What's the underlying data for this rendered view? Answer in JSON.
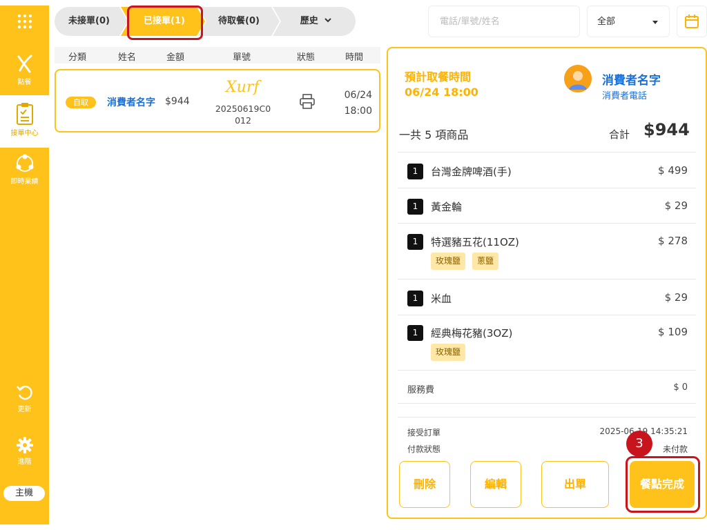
{
  "sidebar": {
    "items": [
      {
        "label": "點餐"
      },
      {
        "label": "接單中心"
      },
      {
        "label": "即時業績"
      },
      {
        "label": "更新"
      },
      {
        "label": "進階"
      }
    ],
    "host_label": "主機"
  },
  "tabs": [
    {
      "label": "未接單(0)"
    },
    {
      "label": "已接單(1)"
    },
    {
      "label": "待取餐(0)"
    },
    {
      "label": "歷史"
    }
  ],
  "search": {
    "placeholder": "電話/單號/姓名"
  },
  "filter": {
    "value": "全部"
  },
  "list_headers": [
    "分類",
    "姓名",
    "金額",
    "單號",
    "狀態",
    "時間"
  ],
  "order": {
    "type": "自取",
    "name": "消費者名字",
    "amount": "$944",
    "logo": "Xurf",
    "number_line1": "20250619C0",
    "number_line2": "012",
    "date": "06/24",
    "time": "18:00"
  },
  "detail": {
    "pickup_label": "預計取餐時間",
    "pickup_time": "06/24 18:00",
    "customer_name": "消費者名字",
    "customer_phone": "消費者電話",
    "count_text": "一共 5 項商品",
    "total_label": "合計",
    "total": "$944",
    "items": [
      {
        "qty": "1",
        "name": "台灣金牌啤酒(手)",
        "price": "$ 499",
        "options": []
      },
      {
        "qty": "1",
        "name": "黃金輪",
        "price": "$ 29",
        "options": []
      },
      {
        "qty": "1",
        "name": "特選豬五花(11OZ)",
        "price": "$ 278",
        "options": [
          "玫瑰鹽",
          "蔥鹽"
        ]
      },
      {
        "qty": "1",
        "name": "米血",
        "price": "$ 29",
        "options": []
      },
      {
        "qty": "1",
        "name": "經典梅花豬(3OZ)",
        "price": "$ 109",
        "options": [
          "玫瑰鹽"
        ]
      }
    ],
    "service_fee_label": "服務費",
    "service_fee": "$ 0",
    "accepted_label": "接受訂單",
    "accepted_time": "2025-06-19 14:35:21",
    "payment_label": "付款狀態",
    "payment_status": "未付款",
    "buttons": {
      "delete": "刪除",
      "edit": "編輯",
      "print": "出單",
      "complete": "餐點完成"
    }
  },
  "annotation": {
    "step": "3"
  },
  "colors": {
    "brand": "#FFC21A",
    "accent_text": "#FFB300",
    "link": "#1a6fd8",
    "highlight": "#C8151D"
  }
}
